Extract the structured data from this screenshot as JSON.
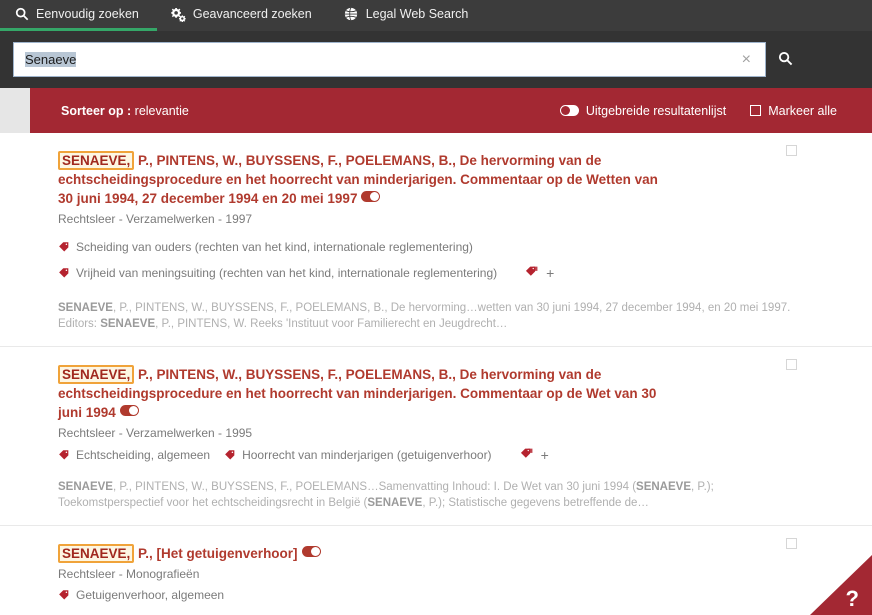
{
  "colors": {
    "nav_bg": "#3c3c3c",
    "nav_active_underline": "#35a768",
    "search_bg": "#333333",
    "toolbar_red": "#a32833",
    "title_red": "#b03a2e",
    "highlight_border": "#f0a33a",
    "highlight_bg": "#fdf6e3",
    "tag_red": "#b5232f",
    "snippet_gray": "#b0b0b0"
  },
  "topnav": {
    "tabs": [
      {
        "label": "Eenvoudig zoeken",
        "icon": "search-icon",
        "active": true
      },
      {
        "label": "Geavanceerd zoeken",
        "icon": "gears-icon",
        "active": false
      },
      {
        "label": "Legal Web Search",
        "icon": "globe-icon",
        "active": false
      }
    ]
  },
  "search": {
    "value": "Senaeve",
    "placeholder": "",
    "clear_label": "×",
    "clear_icon": "close-icon",
    "submit_icon": "search-icon"
  },
  "toolbar": {
    "sort_prefix": "Sorteer op",
    "sort_separator": ":",
    "sort_value": "relevantie",
    "extended_list_label": "Uitgebreide resultatenlijst",
    "extended_list_on": false,
    "mark_all_label": "Markeer alle",
    "mark_all_checked": false
  },
  "results": [
    {
      "highlight": "SENAEVE,",
      "title_rest": " P., PINTENS, W., BUYSSENS, F., POELEMANS, B., De hervorming van de echtscheidingsprocedure en het hoorrecht van minderjarigen. Commentaar op de Wetten van 30 juni 1994, 27 december 1994 en 20 mei 1997",
      "meta": "Rechtsleer - Verzamelwerken - 1997",
      "tags_stacked": true,
      "tags": [
        "Scheiding van ouders (rechten van het kind, internationale reglementering)",
        "Vrijheid van meningsuiting (rechten van het kind, internationale reglementering)"
      ],
      "more_tags_label": "+",
      "snippet_html": "<b>SENAEVE</b>, P., PINTENS, W., BUYSSENS, F., POELEMANS, B., De hervorming…wetten van 30 juni 1994, 27 december 1994, en 20 mei 1997. Editors: <b>SENAEVE</b>, P., PINTENS, W. Reeks 'Instituut voor Familierecht en Jeugdrecht…",
      "checkbox_checked": false
    },
    {
      "highlight": "SENAEVE,",
      "title_rest": " P., PINTENS, W., BUYSSENS, F., POELEMANS, B., De hervorming van de echtscheidingsprocedure en het hoorrecht van minderjarigen. Commentaar op de Wet van 30 juni 1994",
      "meta": "Rechtsleer - Verzamelwerken - 1995",
      "tags_stacked": false,
      "tags": [
        "Echtscheiding, algemeen",
        "Hoorrecht van minderjarigen (getuigenverhoor)"
      ],
      "more_tags_label": "+",
      "snippet_html": "<b>SENAEVE</b>, P., PINTENS, W., BUYSSENS, F., POELEMANS…Samenvatting Inhoud: I. De Wet van 30 juni 1994 (<b>SENAEVE</b>, P.); Toekomstperspectief voor het echtscheidingsrecht in België (<b>SENAEVE</b>, P.); Statistische gegevens betreffende de…",
      "checkbox_checked": false
    },
    {
      "highlight": "SENAEVE,",
      "title_rest": " P., [Het getuigenverhoor]",
      "meta": "Rechtsleer - Monografieën",
      "tags_stacked": false,
      "tags": [
        "Getuigenverhoor, algemeen"
      ],
      "more_tags_label": "",
      "snippet_html": "",
      "checkbox_checked": false
    }
  ],
  "help": {
    "label": "?",
    "icon": "question-mark-icon"
  }
}
